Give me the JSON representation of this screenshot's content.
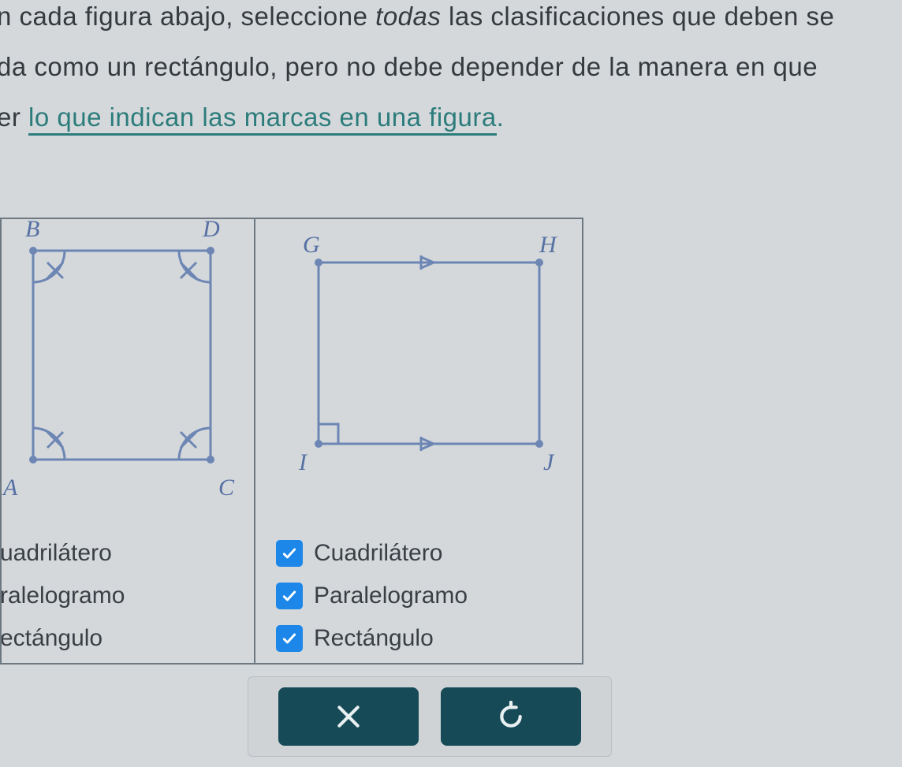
{
  "instructions": {
    "line1_pre": "n cada figura abajo, seleccione ",
    "line1_italic": "todas",
    "line1_post": " las clasificaciones que deben se",
    "line2": "da como un rectángulo, pero no debe depender de la manera en que",
    "line3_pre": "er ",
    "line3_link": "lo que indican las marcas en una figura",
    "line3_post": "."
  },
  "figure_left": {
    "labelB": "B",
    "labelD": "D",
    "labelA": "A",
    "labelC": "C",
    "options": [
      {
        "label": "uadrilátero",
        "checked": false
      },
      {
        "label": "ralelogramo",
        "checked": false
      },
      {
        "label": "ectángulo",
        "checked": false
      }
    ]
  },
  "figure_right": {
    "labelG": "G",
    "labelH": "H",
    "labelI": "I",
    "labelJ": "J",
    "options": [
      {
        "label": "Cuadrilátero",
        "checked": true
      },
      {
        "label": "Paralelogramo",
        "checked": true
      },
      {
        "label": "Rectángulo",
        "checked": true
      }
    ]
  },
  "buttons": {
    "close": "close",
    "reset": "reset"
  }
}
